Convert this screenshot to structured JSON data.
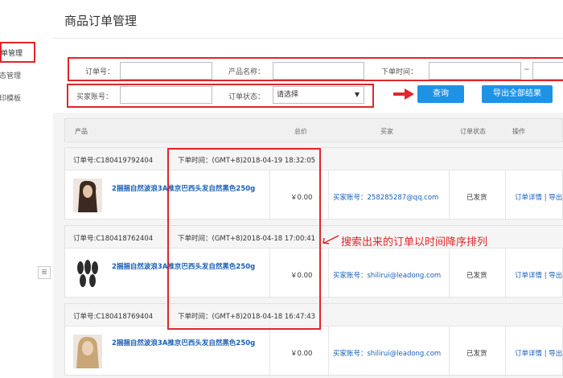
{
  "header": {
    "title": "商品订单管理"
  },
  "sidebar": {
    "items": [
      {
        "label": "订单管理"
      },
      {
        "label": "状态管理"
      },
      {
        "label": "打印模板"
      }
    ],
    "toggle_icon": "≣"
  },
  "filters": {
    "order_no_label": "订单号：",
    "product_name_label": "产品名称：",
    "order_time_label": "下单时间：",
    "tilde": "~",
    "buyer_account_label": "买家账号：",
    "order_status_label": "订单状态：",
    "order_status_value": "请选择",
    "query_button": "查询",
    "export_button": "导出全部结果"
  },
  "table": {
    "columns": [
      "产品",
      "总价",
      "买家",
      "订单状态",
      "操作"
    ],
    "orders": [
      {
        "order_no": "订单号:C180419792404",
        "time": "下单时间：(GMT+8)2018-04-19 18:32:05",
        "product": "2捆捆自然波浪3A推京巴西头发自然黑色250g",
        "price": "￥0.00",
        "buyer": "买家账号：258285287@qq.com",
        "status": "已发货",
        "ops": "订单详情 | 导出"
      },
      {
        "order_no": "订单号:C180418762404",
        "time": "下单时间：(GMT+8)2018-04-18 17:00:41",
        "product": "2捆捆自然波浪3A推京巴西头发自然黑色250g",
        "price": "￥0.00",
        "buyer": "买家账号：shilirui@leadong.com",
        "status": "已发货",
        "ops": "订单详情 | 导出"
      },
      {
        "order_no": "订单号:C180418769404",
        "time": "下单时间：(GMT+8)2018-04-18 16:47:43",
        "product": "2捆捆自然波浪3A推京巴西头发自然黑色250g",
        "price": "￥0.00",
        "buyer": "买家账号：shilirui@leadong.com",
        "status": "已发货",
        "ops": "订单详情 | 导出"
      }
    ]
  },
  "annotation": {
    "text": "搜索出来的订单以时间降序排列"
  },
  "colors": {
    "accent_red": "#e0262b",
    "button_blue": "#1e93e6",
    "link_blue": "#1a5fb4"
  }
}
